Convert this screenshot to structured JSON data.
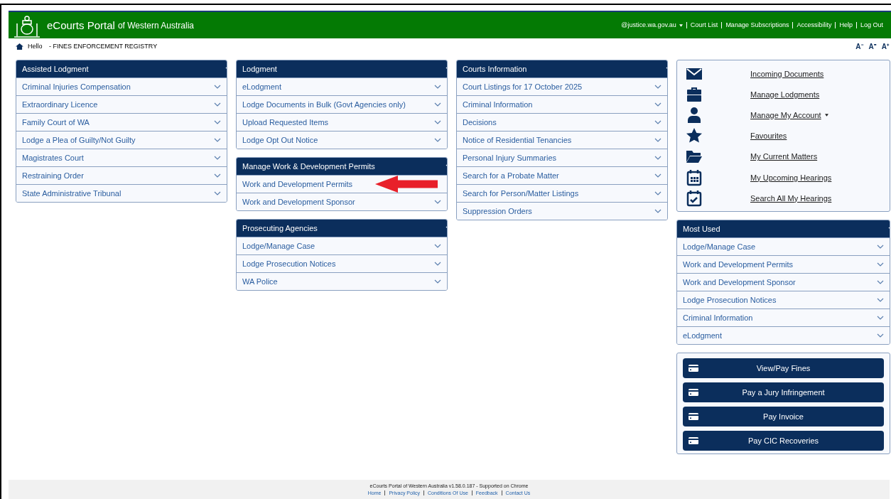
{
  "header": {
    "title": "eCourts Portal",
    "subtitle": "of Western Australia",
    "links": [
      {
        "label": "@justice.wa.gov.au",
        "dropdown": true
      },
      {
        "label": "Court List",
        "dropdown": false
      },
      {
        "label": "Manage Subscriptions",
        "dropdown": false
      },
      {
        "label": "Accessibility",
        "dropdown": false
      },
      {
        "label": "Help",
        "dropdown": false
      },
      {
        "label": "Log Out",
        "dropdown": false
      }
    ]
  },
  "subheader": {
    "greeting": "Hello",
    "registry": "- FINES ENFORCEMENT REGISTRY",
    "font_sizes": [
      "A⁻",
      "A⁼",
      "A⁺"
    ]
  },
  "columns": [
    [
      {
        "title": "Assisted Lodgment",
        "items": [
          {
            "label": "Criminal Injuries Compensation",
            "expandable": true
          },
          {
            "label": "Extraordinary Licence",
            "expandable": true
          },
          {
            "label": "Family Court of WA",
            "expandable": true
          },
          {
            "label": "Lodge a Plea of Guilty/Not Guilty",
            "expandable": true
          },
          {
            "label": "Magistrates Court",
            "expandable": true
          },
          {
            "label": "Restraining Order",
            "expandable": true
          },
          {
            "label": "State Administrative Tribunal",
            "expandable": true
          }
        ]
      }
    ],
    [
      {
        "title": "Lodgment",
        "items": [
          {
            "label": "eLodgment",
            "expandable": true
          },
          {
            "label": "Lodge Documents in Bulk (Govt Agencies only)",
            "expandable": true
          },
          {
            "label": "Upload Requested Items",
            "expandable": true
          },
          {
            "label": "Lodge Opt Out Notice",
            "expandable": true
          }
        ]
      },
      {
        "title": "Manage Work & Development Permits",
        "items": [
          {
            "label": "Work and Development Permits",
            "expandable": false,
            "pointer": true
          },
          {
            "label": "Work and Development Sponsor",
            "expandable": true
          }
        ]
      },
      {
        "title": "Prosecuting Agencies",
        "items": [
          {
            "label": "Lodge/Manage Case",
            "expandable": true
          },
          {
            "label": "Lodge Prosecution Notices",
            "expandable": true
          },
          {
            "label": "WA Police",
            "expandable": true
          }
        ]
      }
    ],
    [
      {
        "title": "Courts Information",
        "items": [
          {
            "label": "Court Listings for 17 October 2025",
            "expandable": true
          },
          {
            "label": "Criminal Information",
            "expandable": true
          },
          {
            "label": "Decisions",
            "expandable": true
          },
          {
            "label": "Notice of Residential Tenancies",
            "expandable": true
          },
          {
            "label": "Personal Injury Summaries",
            "expandable": true
          },
          {
            "label": "Search for a Probate Matter",
            "expandable": true
          },
          {
            "label": "Search for Person/Matter Listings",
            "expandable": true
          },
          {
            "label": "Suppression Orders",
            "expandable": true
          }
        ]
      }
    ]
  ],
  "quick_links": [
    {
      "kind": "envelope",
      "label": "Incoming Documents",
      "dropdown": false
    },
    {
      "kind": "briefcase",
      "label": "Manage Lodgments",
      "dropdown": false
    },
    {
      "kind": "person",
      "label": "Manage My Account",
      "dropdown": true
    },
    {
      "kind": "star",
      "label": "Favourites",
      "dropdown": false
    },
    {
      "kind": "folder",
      "label": "My Current Matters",
      "dropdown": false
    },
    {
      "kind": "calendar",
      "label": "My Upcoming Hearings",
      "dropdown": false
    },
    {
      "kind": "calendarcheck",
      "label": "Search All My Hearings",
      "dropdown": false
    }
  ],
  "most_used": {
    "title": "Most Used",
    "items": [
      {
        "label": "Lodge/Manage Case",
        "expandable": true
      },
      {
        "label": "Work and Development Permits",
        "expandable": true
      },
      {
        "label": "Work and Development Sponsor",
        "expandable": true
      },
      {
        "label": "Lodge Prosecution Notices",
        "expandable": true
      },
      {
        "label": "Criminal Information",
        "expandable": true
      },
      {
        "label": "eLodgment",
        "expandable": true
      }
    ]
  },
  "payments": [
    "View/Pay Fines",
    "Pay a Jury Infringement",
    "Pay Invoice",
    "Pay CIC Recoveries"
  ],
  "footer": {
    "text": "eCourts Portal of Western Australia v1.58.0.187 - Supported on Chrome",
    "links": [
      "Home",
      "Privacy Policy",
      "Conditions Of Use",
      "Feedback",
      "Contact Us"
    ]
  }
}
